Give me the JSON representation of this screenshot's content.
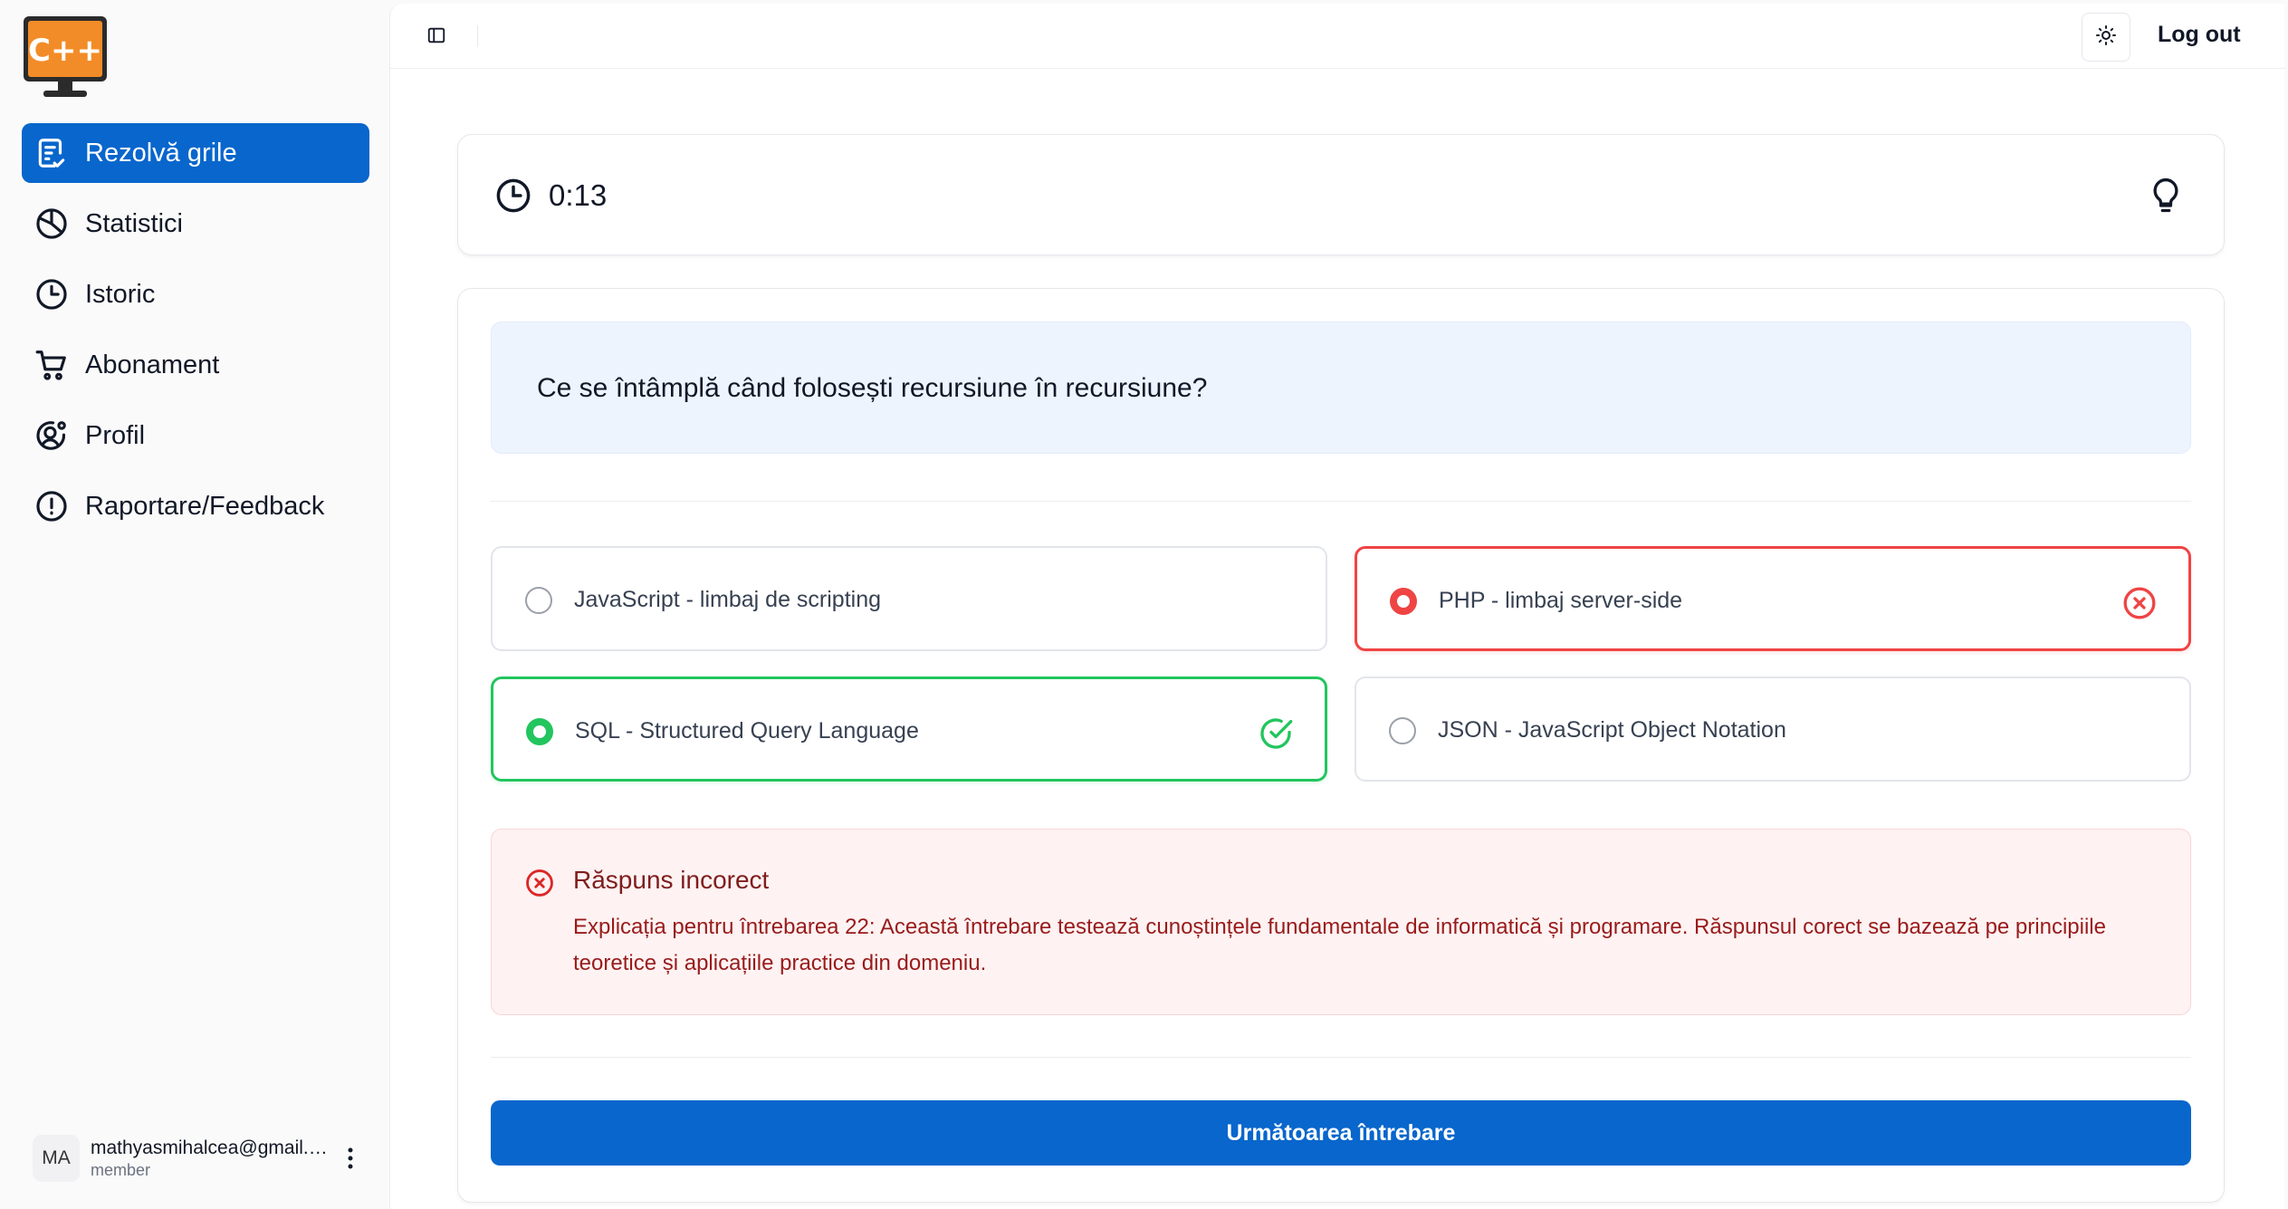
{
  "app": {
    "logo_text": "C++",
    "brand_color": "#0866cc",
    "logo_color": "#f28c28"
  },
  "sidebar": {
    "items": [
      {
        "label": "Rezolvă grile",
        "icon": "quiz-icon",
        "active": true
      },
      {
        "label": "Statistici",
        "icon": "pie-chart-icon",
        "active": false
      },
      {
        "label": "Istoric",
        "icon": "clock-icon",
        "active": false
      },
      {
        "label": "Abonament",
        "icon": "cart-icon",
        "active": false
      },
      {
        "label": "Profil",
        "icon": "user-settings-icon",
        "active": false
      },
      {
        "label": "Raportare/Feedback",
        "icon": "alert-circle-icon",
        "active": false
      }
    ],
    "user": {
      "initials": "MA",
      "email": "mathyasmihalcea@gmail.com",
      "role": "member"
    }
  },
  "header": {
    "logout_label": "Log out",
    "theme_icon": "sun-icon",
    "toggle_icon": "sidebar-toggle-icon"
  },
  "timer": {
    "value": "0:13",
    "hint_icon": "lightbulb-icon"
  },
  "question": {
    "text": "Ce se întâmplă când folosești recursiune în recursiune?",
    "options": [
      {
        "label": "JavaScript - limbaj de scripting",
        "state": "neutral"
      },
      {
        "label": "PHP - limbaj server-side",
        "state": "selected-wrong"
      },
      {
        "label": "SQL - Structured Query Language",
        "state": "correct"
      },
      {
        "label": "JSON - JavaScript Object Notation",
        "state": "neutral"
      }
    ]
  },
  "feedback": {
    "title": "Răspuns incorect",
    "explanation": "Explicația pentru întrebarea 22: Această întrebare testează cunoștințele fundamentale de informatică și programare. Răspunsul corect se bazează pe principiile teoretice și aplicațiile practice din domeniu.",
    "error_color": "#ef4444",
    "success_color": "#22c55e"
  },
  "actions": {
    "next_label": "Următoarea întrebare"
  }
}
